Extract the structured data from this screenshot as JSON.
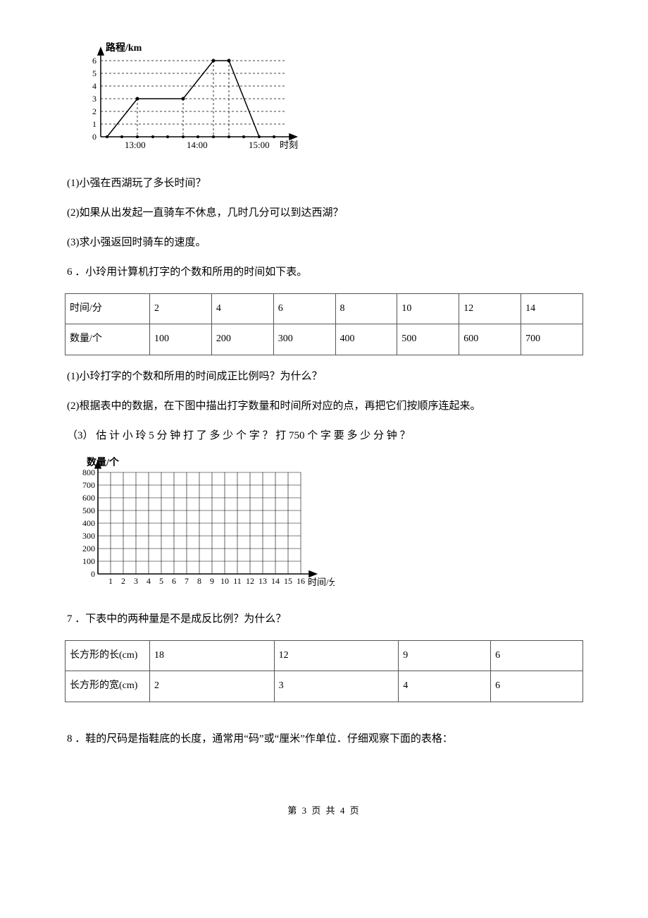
{
  "chart_data": [
    {
      "type": "line",
      "title": "",
      "xlabel": "时刻",
      "ylabel": "路程/km",
      "x_ticks": [
        "13:00",
        "14:00",
        "15:00"
      ],
      "y_ticks": [
        0,
        1,
        2,
        3,
        4,
        5,
        6
      ],
      "ylim": [
        0,
        6
      ],
      "series": [
        {
          "name": "路程",
          "points": [
            {
              "x": "12:30",
              "y": 0
            },
            {
              "x": "13:00",
              "y": 3
            },
            {
              "x": "13:45",
              "y": 3
            },
            {
              "x": "14:15",
              "y": 6
            },
            {
              "x": "14:30",
              "y": 6
            },
            {
              "x": "15:00",
              "y": 0
            }
          ]
        }
      ]
    },
    {
      "type": "line",
      "title": "",
      "xlabel": "时间/分",
      "ylabel": "数量/个",
      "x_ticks": [
        1,
        2,
        3,
        4,
        5,
        6,
        7,
        8,
        9,
        10,
        11,
        12,
        13,
        14,
        15,
        16
      ],
      "y_ticks": [
        0,
        100,
        200,
        300,
        400,
        500,
        600,
        700,
        800
      ],
      "ylim": [
        0,
        800
      ],
      "xlim": [
        0,
        16
      ],
      "series": []
    }
  ],
  "q1_1": "(1)小强在西湖玩了多长时间？",
  "q1_2": "(2)如果从出发起一直骑车不休息，几时几分可以到达西湖？",
  "q1_3": "(3)求小强返回时骑车的速度。",
  "q6_intro": "6 ．小玲用计算机打字的个数和所用的时间如下表。",
  "table1": {
    "rows": [
      [
        "时间/分",
        "2",
        "4",
        "6",
        "8",
        "10",
        "12",
        "14"
      ],
      [
        "数量/个",
        "100",
        "200",
        "300",
        "400",
        "500",
        "600",
        "700"
      ]
    ]
  },
  "q6_1": "(1)小玲打字的个数和所用的时间成正比例吗？为什么？",
  "q6_2": "(2)根据表中的数据，在下图中描出打字数量和时间所对应的点，再把它们按顺序连起来。",
  "q6_3": "（3） 估 计 小 玲 5 分 钟 打 了 多 少 个 字 ？ 打 750 个 字 要 多 少 分 钟 ？",
  "q7_intro": "7 ．下表中的两种量是不是成反比例？为什么？",
  "table3": {
    "rows": [
      [
        "长方形的长(cm)",
        "18",
        "12",
        "9",
        "6"
      ],
      [
        "长方形的宽(cm)",
        "2",
        "3",
        "4",
        "6"
      ]
    ]
  },
  "q8_intro": "8 ．鞋的尺码是指鞋底的长度，通常用“码”或“厘米”作单位．仔细观察下面的表格：",
  "footer": "第 3 页 共 4 页"
}
